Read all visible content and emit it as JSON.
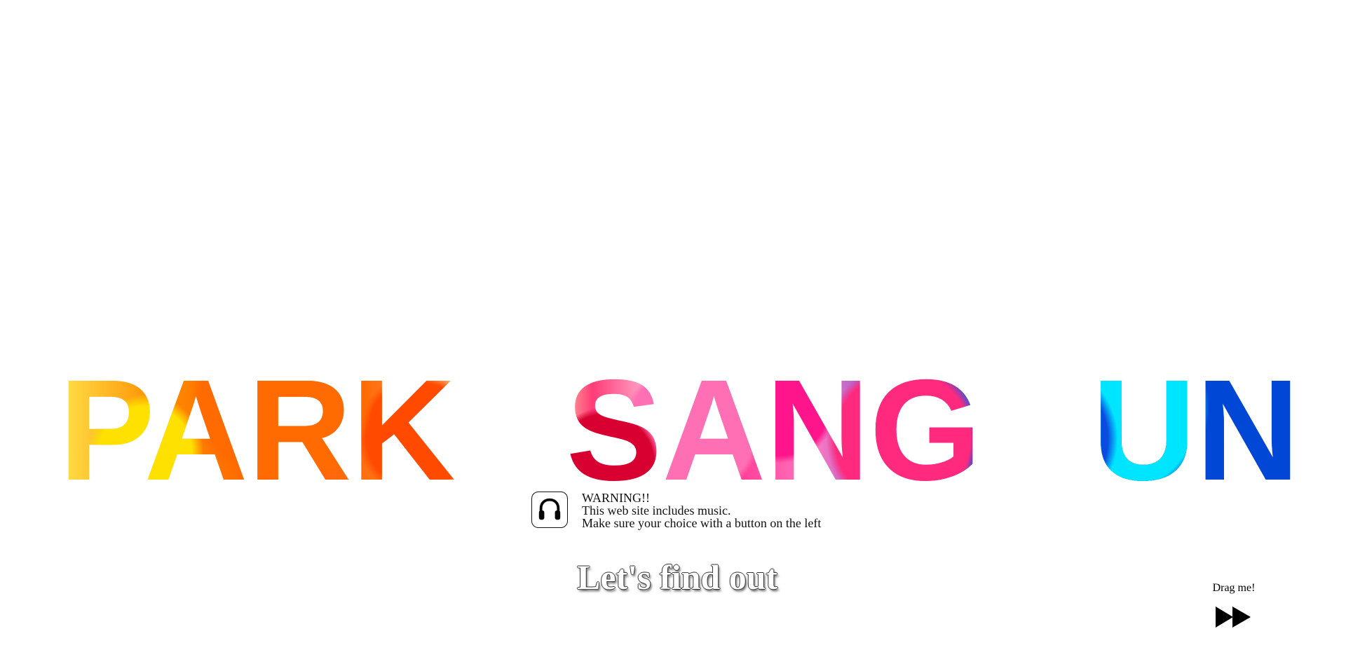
{
  "hero": {
    "words": [
      "PARK",
      "SANG",
      "UN"
    ]
  },
  "warning": {
    "line1": "WARNING!!",
    "line2": "This web site includes music.",
    "line3": "Make sure your choice with a button on the left",
    "icon": "headphones-icon"
  },
  "cta": {
    "label": "Let's find out"
  },
  "drag": {
    "label": "Drag me!",
    "icon": "fast-forward-icon"
  },
  "colors": {
    "text": "#000000",
    "background": "#ffffff",
    "orange": "#ff7a00",
    "pink": "#ff2d8c",
    "blue": "#0a57d8"
  }
}
